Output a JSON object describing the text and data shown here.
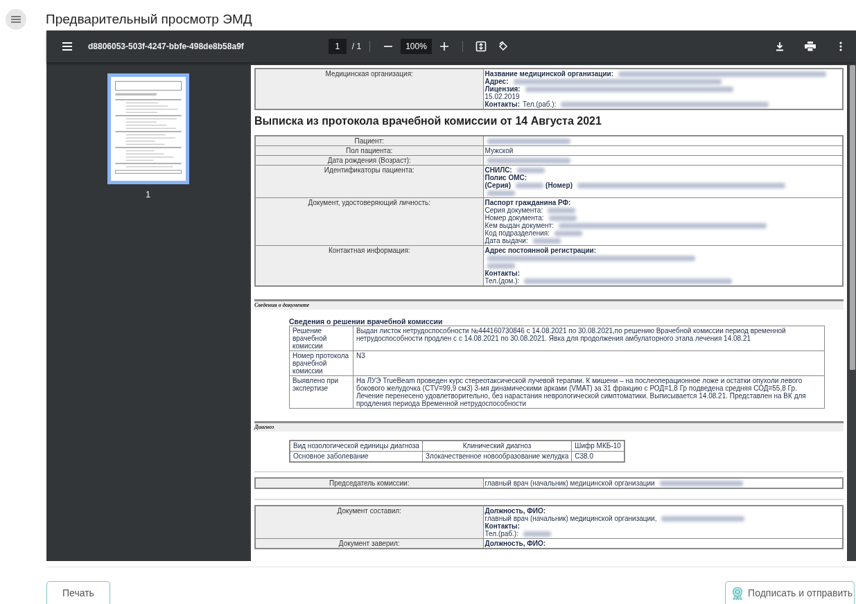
{
  "page_title": "Предварительный просмотр ЭМД",
  "viewer": {
    "file_name": "d8806053-503f-4247-bbfe-498de8b58a9f",
    "page_input": "1",
    "page_total": "/ 1",
    "zoom": "100%",
    "thumbnails": [
      {
        "label": "1",
        "selected": true
      }
    ],
    "document": [
      {
        "kind": "info_table",
        "rows": [
          {
            "label": "Медицинская организация:",
            "lines": [
              [
                {
                  "kind": "bold",
                  "text": "Название медицинской организации:"
                },
                {
                  "kind": "blur_long"
                }
              ],
              [
                {
                  "kind": "bold",
                  "text": "Адрес:"
                },
                {
                  "kind": "blur_long"
                }
              ],
              [
                {
                  "kind": "bold",
                  "text": "Лицензия:"
                },
                {
                  "kind": "blur_long"
                }
              ],
              [
                {
                  "kind": "text",
                  "text": "15.02.2019"
                }
              ],
              [
                {
                  "kind": "bold",
                  "text": "Контакты:"
                },
                {
                  "kind": "text",
                  "text": "Тел.(раб.):"
                },
                {
                  "kind": "blur_long"
                }
              ]
            ]
          }
        ]
      },
      {
        "kind": "heading",
        "text": "Выписка из протокола врачебной комиссии от 14 Августа 2021"
      },
      {
        "kind": "info_table",
        "rows": [
          {
            "label": "Пациент:",
            "lines": [
              [
                {
                  "kind": "blur"
                }
              ]
            ]
          },
          {
            "label": "Пол пациента:",
            "lines": [
              [
                {
                  "kind": "text",
                  "text": "Мужской"
                }
              ]
            ]
          },
          {
            "label": "Дата рождения (Возраст):",
            "lines": [
              [
                {
                  "kind": "blur"
                }
              ]
            ]
          },
          {
            "label": "Идентификаторы пациента:",
            "lines": [
              [
                {
                  "kind": "bold",
                  "text": "СНИЛС:"
                },
                {
                  "kind": "blur_short"
                }
              ],
              [
                {
                  "kind": "bold",
                  "text": "Полис ОМС:"
                }
              ],
              [
                {
                  "kind": "bold",
                  "text": "(Серия)"
                },
                {
                  "kind": "blur_short"
                },
                {
                  "kind": "bold",
                  "text": "(Номер)"
                },
                {
                  "kind": "blur_long"
                }
              ],
              [
                {
                  "kind": "blur_short"
                }
              ]
            ]
          },
          {
            "label": "Документ, удостоверяющий личность:",
            "lines": [
              [
                {
                  "kind": "bold",
                  "text": "Паспорт гражданина РФ:"
                }
              ],
              [
                {
                  "kind": "text",
                  "text": "Серия документа:"
                },
                {
                  "kind": "blur_short"
                }
              ],
              [
                {
                  "kind": "text",
                  "text": "Номер документа:"
                },
                {
                  "kind": "blur_short"
                }
              ],
              [
                {
                  "kind": "text",
                  "text": "Кем выдан документ:"
                },
                {
                  "kind": "blur_long"
                }
              ],
              [
                {
                  "kind": "text",
                  "text": "Код подразделения:"
                },
                {
                  "kind": "blur_short"
                }
              ],
              [
                {
                  "kind": "text",
                  "text": "Дата выдачи:"
                },
                {
                  "kind": "blur_short"
                }
              ]
            ]
          },
          {
            "label": "Контактная информация:",
            "lines": [
              [
                {
                  "kind": "bold",
                  "text": "Адрес постоянной регистрации:"
                }
              ],
              [
                {
                  "kind": "blur_long"
                }
              ],
              [
                {
                  "kind": "blur_short"
                }
              ],
              [
                {
                  "kind": "bold",
                  "text": "Контакты:"
                }
              ],
              [
                {
                  "kind": "text",
                  "text": "Тел.(дом.):"
                },
                {
                  "kind": "blur_long"
                }
              ]
            ]
          }
        ]
      },
      {
        "kind": "section",
        "title": "Сведения о документе"
      },
      {
        "kind": "subheading",
        "text": "Сведения о решении врачебной комиссии"
      },
      {
        "kind": "detail_table",
        "rows": [
          {
            "label": "Решение врачебной комиссии",
            "value": "Выдан листок нетрудоспособности №444160730846 с 14.08.2021 по 30.08.2021,по решению Врачебной комиссии период временной нетрудоспособности продлен с с 14.08.2021 по 30.08.2021. Явка для продолжения амбулаторного этапа лечения 14.08.21"
          },
          {
            "label": "Номер протокола врачебной комиссии",
            "value": "N3"
          },
          {
            "label": "Выявлено при экспертизе",
            "value": "На ЛУЭ TrueBeam проведен курс стереотаксической лучевой терапии. К мишени – на послеоперационное ложе и остатки опухоли левого бокового желудочка (CTV=99,9 см3) 3-мя динамическими арками (VMAT) за 31 фракцию с РОД=1,8 Гр подведена средняя СОД=55,8 Гр. Лечение перенесено удовлетворительно, без нарастания неврологической симптоматики. Выписывается 14.08.21. Представлен на ВК для продления периода Временной нетрудоспособности"
          }
        ]
      },
      {
        "kind": "section",
        "title": "Диагноз"
      },
      {
        "kind": "grid_table",
        "columns": [
          "Вид нозологической единицы диагноза",
          "Клинический диагноз",
          "Шифр МКБ-10"
        ],
        "rows": [
          [
            "Основное заболевание",
            "Злокачественное новообразование желудка",
            "C38.0"
          ]
        ]
      },
      {
        "kind": "divider"
      },
      {
        "kind": "info_table",
        "rows": [
          {
            "label": "Председатель комиссии:",
            "lines": [
              [
                {
                  "kind": "text",
                  "text": "главный врач (начальник) медицинской организации"
                },
                {
                  "kind": "blur"
                }
              ]
            ]
          }
        ]
      },
      {
        "kind": "divider"
      },
      {
        "kind": "info_table",
        "rows": [
          {
            "label": "Документ составил:",
            "lines": [
              [
                {
                  "kind": "bold",
                  "text": "Должность, ФИО:"
                }
              ],
              [
                {
                  "kind": "text",
                  "text": "главный врач (начальник) медицинской организации,"
                },
                {
                  "kind": "blur"
                }
              ],
              [
                {
                  "kind": "bold",
                  "text": "Контакты:"
                }
              ],
              [
                {
                  "kind": "text",
                  "text": "Тел.(раб.):"
                },
                {
                  "kind": "blur_short"
                }
              ]
            ]
          },
          {
            "label": "Документ заверил:",
            "lines": [
              [
                {
                  "kind": "bold",
                  "text": "Должность, ФИО:"
                }
              ]
            ]
          }
        ]
      }
    ]
  },
  "buttons": [
    {
      "label": "Печать",
      "kind": "print"
    },
    {
      "label": "Подписать и отправить",
      "kind": "sign"
    }
  ]
}
